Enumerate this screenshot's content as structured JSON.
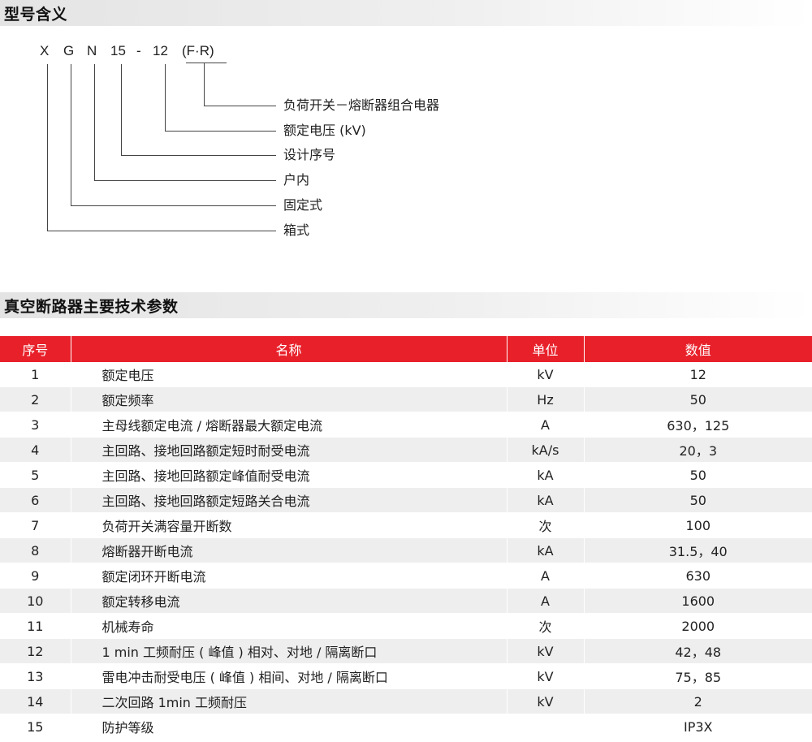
{
  "section1": {
    "title": "型号含义"
  },
  "code": {
    "chars": [
      "X",
      "G",
      "N",
      "15",
      "-",
      "12",
      "(F·R)"
    ]
  },
  "meanings": [
    "负荷开关－熔断器组合电器",
    "额定电压 (kV)",
    "设计序号",
    "户内",
    "固定式",
    "箱式"
  ],
  "section2": {
    "title": "真空断路器主要技术参数"
  },
  "table": {
    "headers": [
      "序号",
      "名称",
      "单位",
      "数值"
    ],
    "rows": [
      {
        "idx": "1",
        "name": "额定电压",
        "unit": "kV",
        "value": "12"
      },
      {
        "idx": "2",
        "name": "额定频率",
        "unit": "Hz",
        "value": "50"
      },
      {
        "idx": "3",
        "name": "主母线额定电流 / 熔断器最大额定电流",
        "unit": "A",
        "value": "630，125"
      },
      {
        "idx": "4",
        "name": "主回路、接地回路额定短时耐受电流",
        "unit": "kA/s",
        "value": "20，3"
      },
      {
        "idx": "5",
        "name": "主回路、接地回路额定峰值耐受电流",
        "unit": "kA",
        "value": "50"
      },
      {
        "idx": "6",
        "name": "主回路、接地回路额定短路关合电流",
        "unit": "kA",
        "value": "50"
      },
      {
        "idx": "7",
        "name": "负荷开关满容量开断数",
        "unit": "次",
        "value": "100"
      },
      {
        "idx": "8",
        "name": "熔断器开断电流",
        "unit": "kA",
        "value": "31.5，40"
      },
      {
        "idx": "9",
        "name": "额定闭环开断电流",
        "unit": "A",
        "value": "630"
      },
      {
        "idx": "10",
        "name": "额定转移电流",
        "unit": "A",
        "value": "1600"
      },
      {
        "idx": "11",
        "name": "机械寿命",
        "unit": "次",
        "value": "2000"
      },
      {
        "idx": "12",
        "name": "1 min 工频耐压 ( 峰值 ) 相对、对地 / 隔离断口",
        "unit": "kV",
        "value": "42，48"
      },
      {
        "idx": "13",
        "name": "雷电冲击耐受电压 ( 峰值 ) 相间、对地 / 隔离断口",
        "unit": "kV",
        "value": "75，85"
      },
      {
        "idx": "14",
        "name": "二次回路 1min 工频耐压",
        "unit": "kV",
        "value": "2"
      },
      {
        "idx": "15",
        "name": "防护等级",
        "unit": "",
        "value": "IP3X"
      }
    ]
  }
}
